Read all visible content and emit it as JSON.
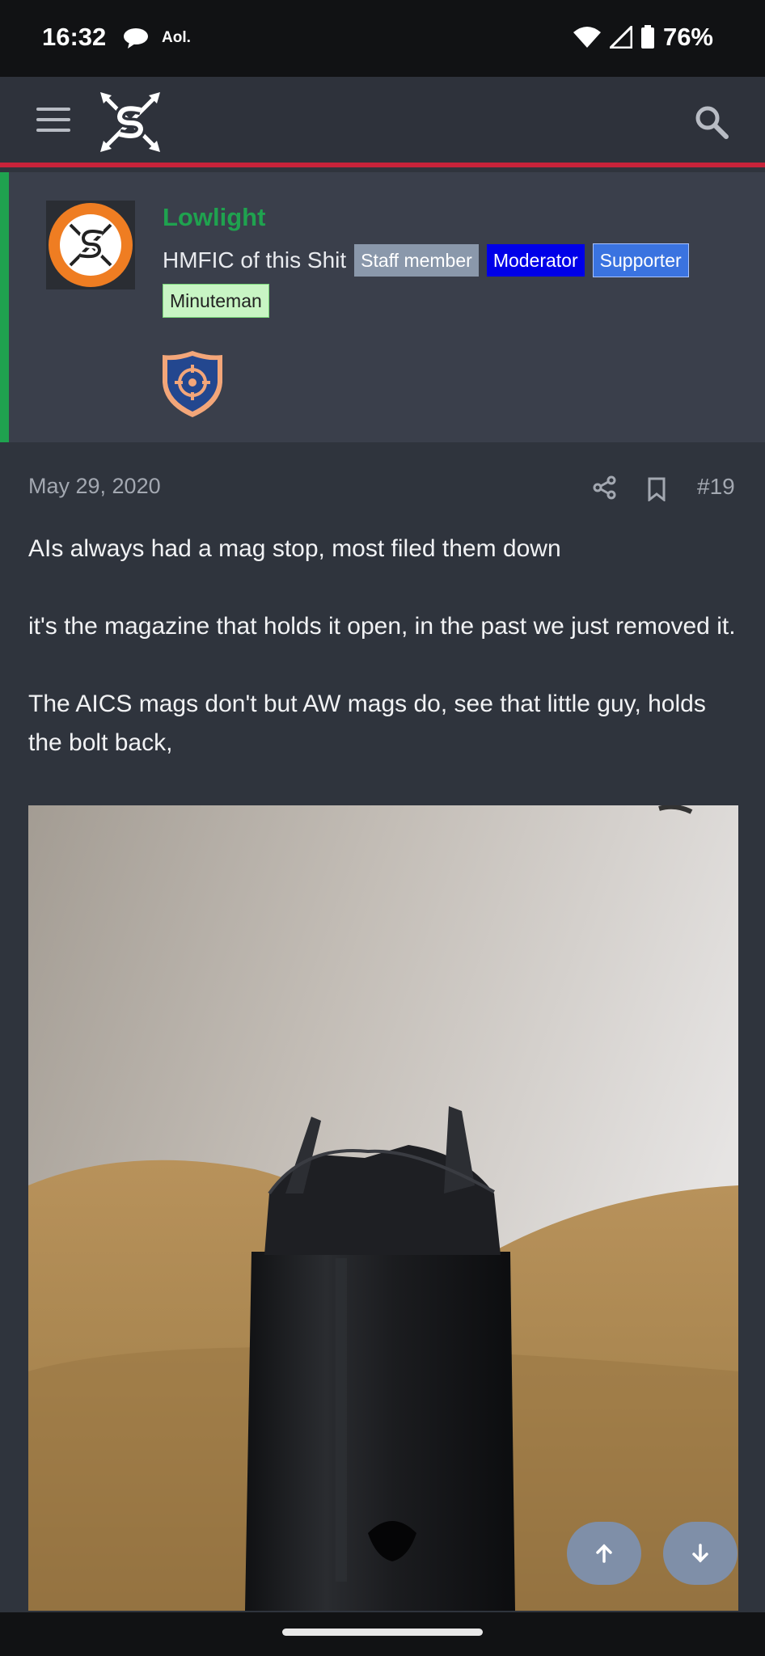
{
  "status_bar": {
    "time": "16:32",
    "carrier_label": "Aol.",
    "battery": "76%"
  },
  "header": {
    "menu_icon": "hamburger-icon",
    "logo_icon": "crossed-arrows-logo-icon",
    "search_icon": "search-icon",
    "accent_color": "#c8233a"
  },
  "member": {
    "username": "Lowlight",
    "title": "HMFIC of this Shit",
    "badges": {
      "staff": "Staff member",
      "moderator": "Moderator",
      "supporter": "Supporter",
      "minuteman": "Minuteman"
    },
    "trophy_icon": "crosshair-shield-icon",
    "accent_color": "#1fa24f"
  },
  "post": {
    "date": "May 29, 2020",
    "number": "#19",
    "paragraphs": {
      "p1": "AIs always had a mag stop, most filed them down",
      "p2": "it's the magazine that holds it open, in the past we just removed it.",
      "p3": "The AICS mags don't but AW mags do, see that little guy, holds the bolt back,"
    }
  },
  "controls": {
    "scroll_up_icon": "arrow-up-icon",
    "scroll_down_icon": "arrow-down-icon"
  }
}
